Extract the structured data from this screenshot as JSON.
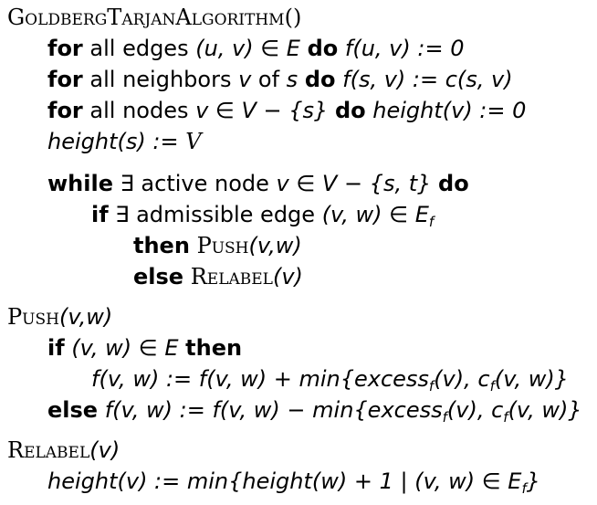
{
  "proc": {
    "main": "GoldbergTarjanAlgorithm()",
    "push": "Push",
    "push_args": "(v,w)",
    "relabel": "Relabel",
    "relabel_args": "(v)"
  },
  "kw": {
    "for": "for",
    "do": "do",
    "while": "while",
    "if": "if",
    "then": "then",
    "else": "else"
  },
  "text": {
    "l1_a": " all edges ",
    "l1_b": "(u, v) ∈ E",
    "l1_c": "f(u, v) := 0",
    "l2_a": " all neighbors ",
    "l2_b": "v",
    "l2_c": " of ",
    "l2_d": "s",
    "l2_e": "f(s, v) := c(s, v)",
    "l3_a": " all nodes ",
    "l3_b": "v ∈ V − {s}",
    "l3_c": "height(v) := 0",
    "l4_a": "height(s) := ",
    "l4_b": "V",
    "l5_a": " ∃ active node ",
    "l5_b": "v ∈ V − {s, t}",
    "l6_a": " ∃ admissible edge ",
    "l6_b": "(v, w) ∈ E",
    "l6_sub": "f",
    "l9_a": " ",
    "l9_b": "(v, w) ∈ E",
    "l10_a": "f(v, w) := f(v, w) + min{",
    "l10_b": "excess",
    "l10_sub1": "f",
    "l10_c": "(v), c",
    "l10_sub2": "f",
    "l10_d": "(v, w)}",
    "l11_a": " f(v, w) := f(v, w) − min{",
    "l11_b": "excess",
    "l11_sub1": "f",
    "l11_c": "(v), c",
    "l11_sub2": "f",
    "l11_d": "(v, w)}",
    "l13_a": "height(v) := min{height(w) + 1 | (v, w) ∈ E",
    "l13_sub": "f",
    "l13_b": "}"
  }
}
